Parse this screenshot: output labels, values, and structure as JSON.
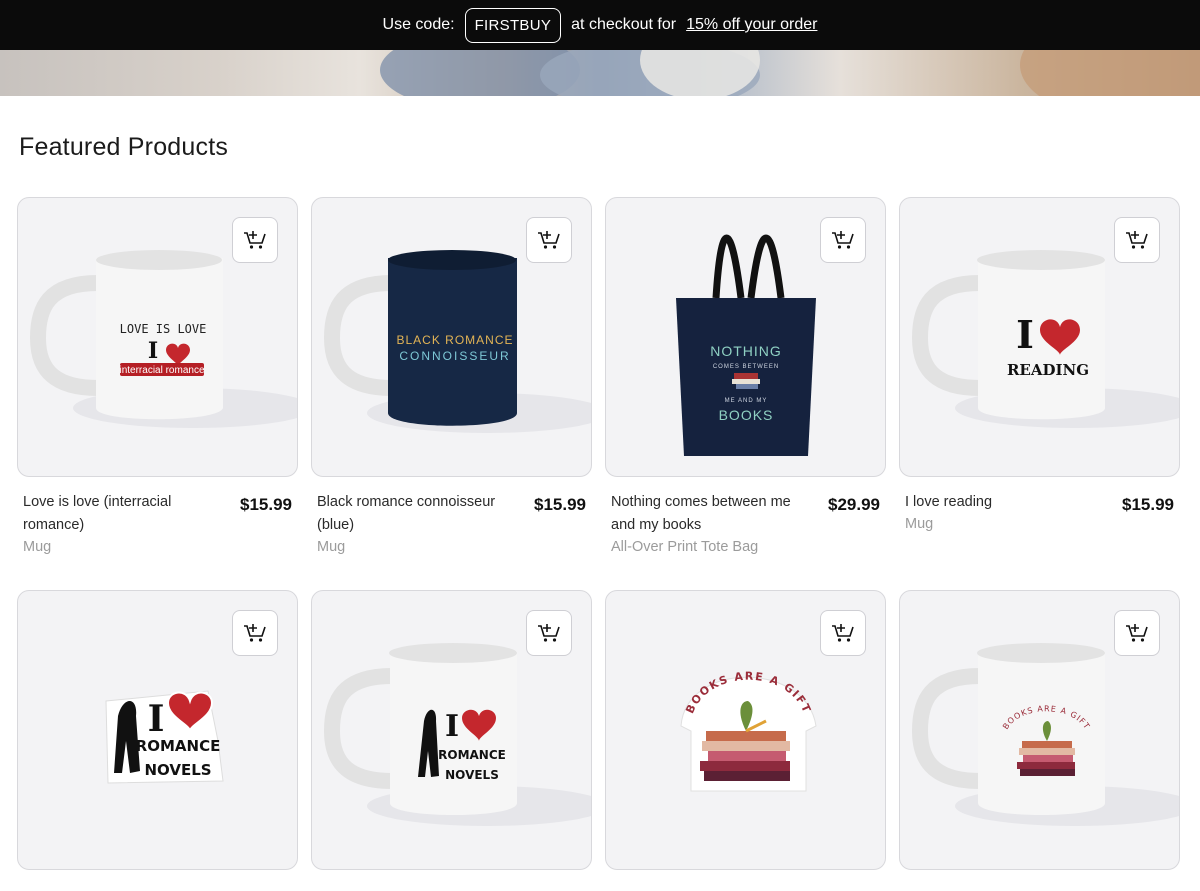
{
  "promo": {
    "prefix": "Use code:",
    "code": "FIRSTBUY",
    "middle": "at checkout for",
    "link": "15% off your order"
  },
  "section_title": "Featured Products",
  "cart_icon": "add-to-cart-icon",
  "products": [
    {
      "name": "Love is love (interracial romance)",
      "price": "$15.99",
      "type": "Mug",
      "art": {
        "line1": "LOVE IS LOVE",
        "line2": "I",
        "banner": "interracial romance"
      }
    },
    {
      "name": "Black romance connoisseur (blue)",
      "price": "$15.99",
      "type": "Mug",
      "art": {
        "line1": "BLACK ROMANCE",
        "line2": "CONNOISSEUR"
      }
    },
    {
      "name": "Nothing comes between me and my books",
      "price": "$29.99",
      "type": "All-Over Print Tote Bag",
      "art": {
        "line1": "NOTHING",
        "line2": "COMES BETWEEN",
        "line3": "ME AND MY",
        "line4": "BOOKS"
      }
    },
    {
      "name": "I love reading",
      "price": "$15.99",
      "type": "Mug",
      "art": {
        "line1": "I",
        "line2": "READING"
      }
    },
    {
      "name": "",
      "price": "",
      "type": "",
      "art": {
        "line1": "I",
        "line2": "ROMANCE",
        "line3": "NOVELS"
      }
    },
    {
      "name": "",
      "price": "",
      "type": "",
      "art": {
        "line1": "I",
        "line2": "ROMANCE",
        "line3": "NOVELS"
      }
    },
    {
      "name": "",
      "price": "",
      "type": "",
      "art": {
        "line1": "BOOKS ARE A GIFT"
      }
    },
    {
      "name": "",
      "price": "",
      "type": "",
      "art": {
        "line1": "BOOKS ARE A GIFT"
      }
    }
  ]
}
